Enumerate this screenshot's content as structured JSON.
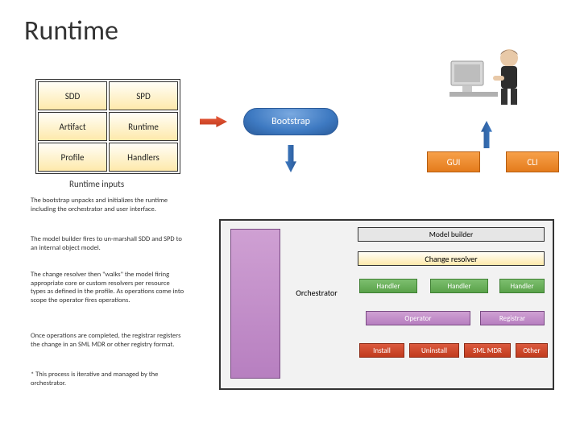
{
  "title": "Runtime",
  "table": {
    "r1c1": "SDD",
    "r1c2": "SPD",
    "r2c1": "Artifact",
    "r2c2": "Runtime",
    "r3c1": "Profile",
    "r3c2": "Handlers",
    "caption": "Runtime inputs"
  },
  "bootstrap": "Bootstrap",
  "gui": "GUI",
  "cli": "CLI",
  "paragraphs": {
    "p1": "The bootstrap unpacks and initializes the runtime including the orchestrator and user interface.",
    "p2": "The model builder fires to un-marshall SDD and SPD to an internal object model.",
    "p3": "The change resolver then \"walks\" the model firing appropriate core or custom resolvers per resource types as defined in the profile. As operations come into scope the operator fires operations.",
    "p4": "Once operations are completed, the registrar registers the change in an SML MDR or other registry format.",
    "p5": "* This process is iterative and managed by the orchestrator."
  },
  "diagram": {
    "model_builder": "Model builder",
    "change_resolver": "Change resolver",
    "orchestrator": "Orchestrator",
    "handler": "Handler",
    "operator": "Operator",
    "registrar": "Registrar",
    "install": "Install",
    "uninstall": "Uninstall",
    "sml_mdr": "SML MDR",
    "other": "Other"
  }
}
